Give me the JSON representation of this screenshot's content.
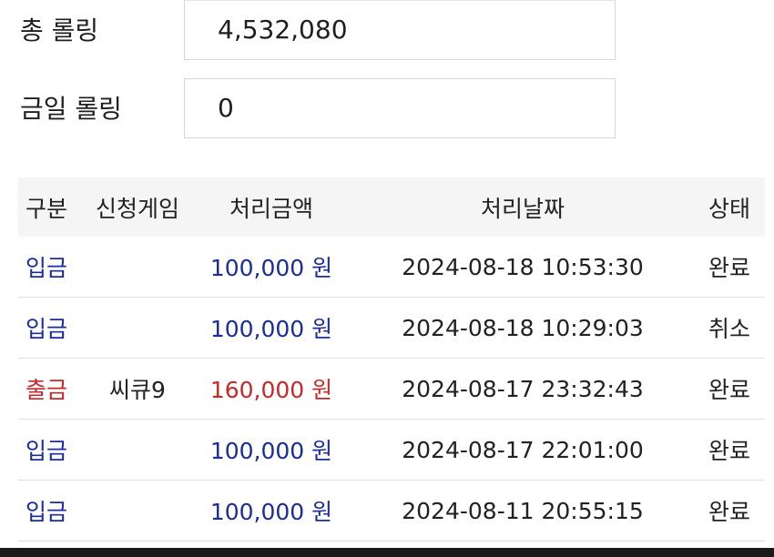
{
  "stats": {
    "total_rolling": {
      "label": "총 롤링",
      "value": "4,532,080"
    },
    "today_rolling": {
      "label": "금일 롤링",
      "value": "0"
    }
  },
  "table": {
    "headers": {
      "type": "구분",
      "game": "신청게임",
      "amount": "처리금액",
      "date": "처리날짜",
      "status": "상태"
    },
    "rows": [
      {
        "type": "입금",
        "game": "",
        "amount": "100,000 원",
        "date": "2024-08-18 10:53:30",
        "status": "완료"
      },
      {
        "type": "입금",
        "game": "",
        "amount": "100,000 원",
        "date": "2024-08-18 10:29:03",
        "status": "취소"
      },
      {
        "type": "출금",
        "game": "씨큐9",
        "amount": "160,000 원",
        "date": "2024-08-17 23:32:43",
        "status": "완료"
      },
      {
        "type": "입금",
        "game": "",
        "amount": "100,000 원",
        "date": "2024-08-17 22:01:00",
        "status": "완료"
      },
      {
        "type": "입금",
        "game": "",
        "amount": "100,000 원",
        "date": "2024-08-11 20:55:15",
        "status": "완료"
      }
    ]
  },
  "colors": {
    "deposit": "#1a2d9a",
    "withdraw": "#c82828",
    "header_bg": "#f5f5f5"
  }
}
